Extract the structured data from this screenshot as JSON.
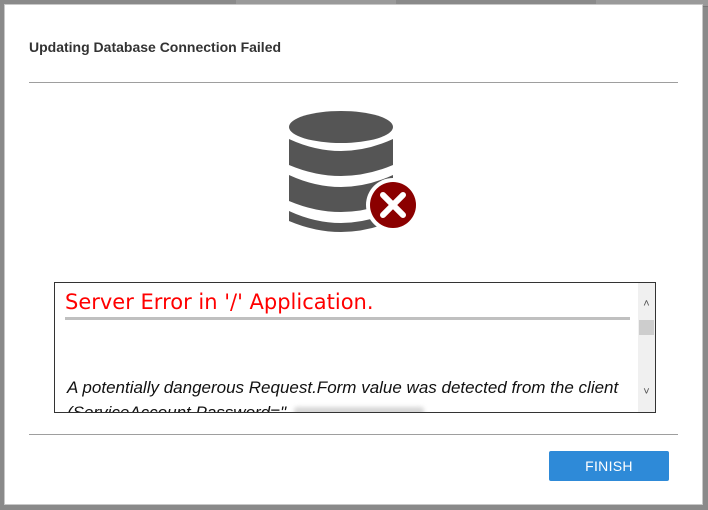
{
  "dialog": {
    "title": "Updating Database Connection Failed",
    "icon": "database-error-icon"
  },
  "error": {
    "heading": "Server Error in '/' Application.",
    "message": "A potentially dangerous Request.Form value was detected from the client (ServiceAccount.Password=\"",
    "heading_color": "#ff0000"
  },
  "actions": {
    "finish_label": "FINISH",
    "finish_color": "#2e8ad8"
  },
  "icons": {
    "scroll_up": "chevron-up-icon",
    "scroll_down": "chevron-down-icon",
    "error_badge": "close-circle-icon"
  }
}
